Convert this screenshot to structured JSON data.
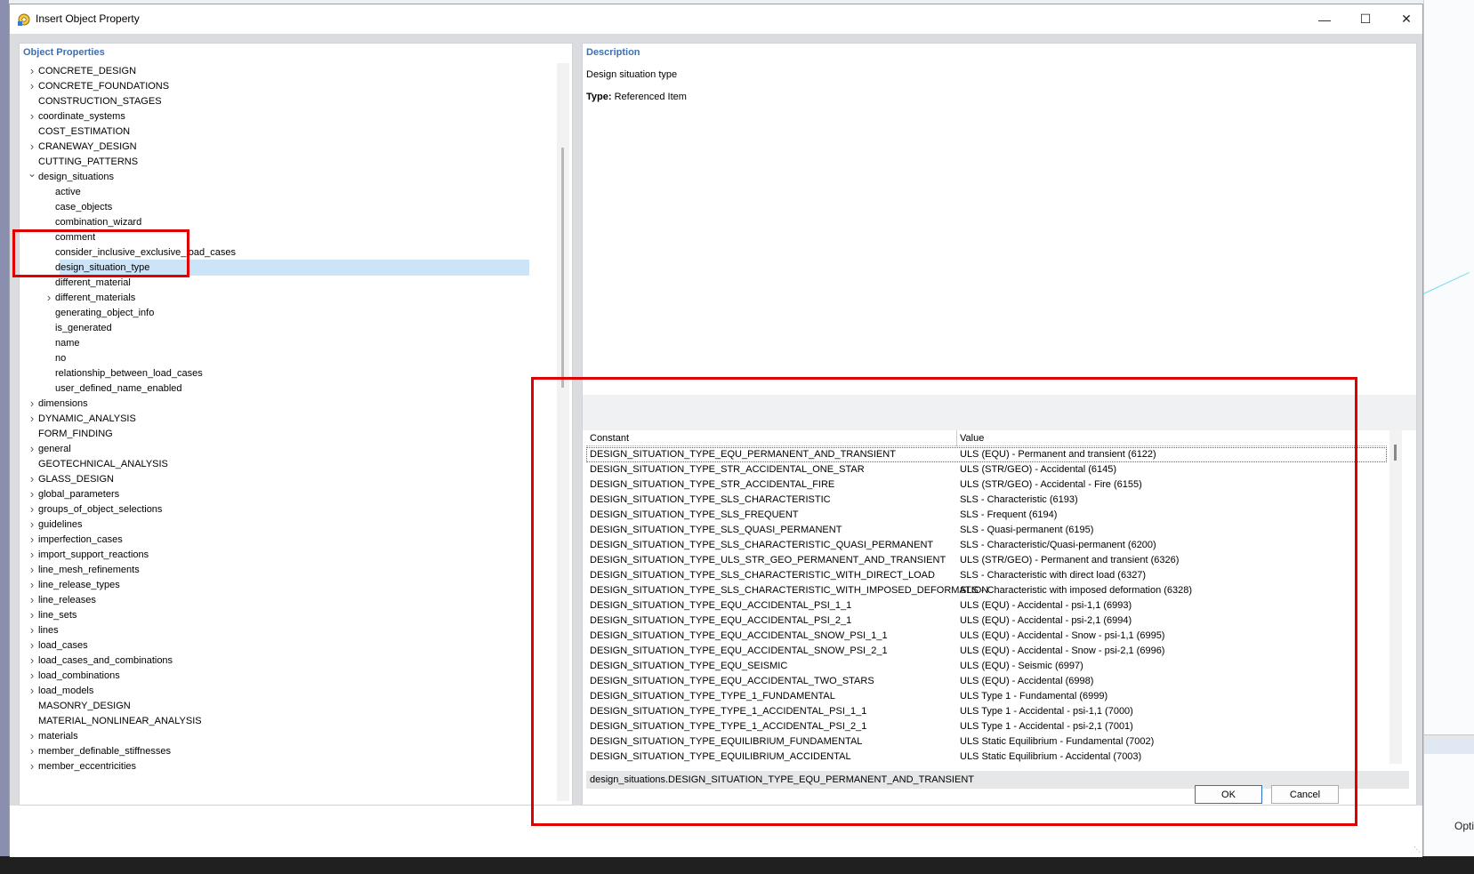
{
  "window": {
    "title": "Insert Object Property"
  },
  "left_panel": {
    "header": "Object Properties",
    "tree": [
      {
        "label": "CONCRETE_DESIGN",
        "expander": "collapsed",
        "level": 0
      },
      {
        "label": "CONCRETE_FOUNDATIONS",
        "expander": "collapsed",
        "level": 0
      },
      {
        "label": "CONSTRUCTION_STAGES",
        "expander": "none",
        "level": 0
      },
      {
        "label": "coordinate_systems",
        "expander": "collapsed",
        "level": 0
      },
      {
        "label": "COST_ESTIMATION",
        "expander": "none",
        "level": 0
      },
      {
        "label": "CRANEWAY_DESIGN",
        "expander": "collapsed",
        "level": 0
      },
      {
        "label": "CUTTING_PATTERNS",
        "expander": "none",
        "level": 0
      },
      {
        "label": "design_situations",
        "expander": "expanded",
        "level": 0
      },
      {
        "label": "active",
        "expander": "none",
        "level": 1
      },
      {
        "label": "case_objects",
        "expander": "none",
        "level": 1
      },
      {
        "label": "combination_wizard",
        "expander": "none",
        "level": 1
      },
      {
        "label": "comment",
        "expander": "none",
        "level": 1
      },
      {
        "label": "consider_inclusive_exclusive_load_cases",
        "expander": "none",
        "level": 1
      },
      {
        "label": "design_situation_type",
        "expander": "none",
        "level": 1,
        "selected": true
      },
      {
        "label": "different_material",
        "expander": "none",
        "level": 1
      },
      {
        "label": "different_materials",
        "expander": "collapsed",
        "level": 1
      },
      {
        "label": "generating_object_info",
        "expander": "none",
        "level": 1
      },
      {
        "label": "is_generated",
        "expander": "none",
        "level": 1
      },
      {
        "label": "name",
        "expander": "none",
        "level": 1
      },
      {
        "label": "no",
        "expander": "none",
        "level": 1
      },
      {
        "label": "relationship_between_load_cases",
        "expander": "none",
        "level": 1
      },
      {
        "label": "user_defined_name_enabled",
        "expander": "none",
        "level": 1
      },
      {
        "label": "dimensions",
        "expander": "collapsed",
        "level": 0
      },
      {
        "label": "DYNAMIC_ANALYSIS",
        "expander": "collapsed",
        "level": 0
      },
      {
        "label": "FORM_FINDING",
        "expander": "none",
        "level": 0
      },
      {
        "label": "general",
        "expander": "collapsed",
        "level": 0
      },
      {
        "label": "GEOTECHNICAL_ANALYSIS",
        "expander": "none",
        "level": 0
      },
      {
        "label": "GLASS_DESIGN",
        "expander": "collapsed",
        "level": 0
      },
      {
        "label": "global_parameters",
        "expander": "collapsed",
        "level": 0
      },
      {
        "label": "groups_of_object_selections",
        "expander": "collapsed",
        "level": 0
      },
      {
        "label": "guidelines",
        "expander": "collapsed",
        "level": 0
      },
      {
        "label": "imperfection_cases",
        "expander": "collapsed",
        "level": 0
      },
      {
        "label": "import_support_reactions",
        "expander": "collapsed",
        "level": 0
      },
      {
        "label": "line_mesh_refinements",
        "expander": "collapsed",
        "level": 0
      },
      {
        "label": "line_release_types",
        "expander": "collapsed",
        "level": 0
      },
      {
        "label": "line_releases",
        "expander": "collapsed",
        "level": 0
      },
      {
        "label": "line_sets",
        "expander": "collapsed",
        "level": 0
      },
      {
        "label": "lines",
        "expander": "collapsed",
        "level": 0
      },
      {
        "label": "load_cases",
        "expander": "collapsed",
        "level": 0
      },
      {
        "label": "load_cases_and_combinations",
        "expander": "collapsed",
        "level": 0
      },
      {
        "label": "load_combinations",
        "expander": "collapsed",
        "level": 0
      },
      {
        "label": "load_models",
        "expander": "collapsed",
        "level": 0
      },
      {
        "label": "MASONRY_DESIGN",
        "expander": "none",
        "level": 0
      },
      {
        "label": "MATERIAL_NONLINEAR_ANALYSIS",
        "expander": "none",
        "level": 0
      },
      {
        "label": "materials",
        "expander": "collapsed",
        "level": 0
      },
      {
        "label": "member_definable_stiffnesses",
        "expander": "collapsed",
        "level": 0
      },
      {
        "label": "member_eccentricities",
        "expander": "collapsed",
        "level": 0
      }
    ]
  },
  "right_panel": {
    "header": "Description",
    "description": "Design situation type",
    "type_label": "Type:",
    "type_value": "Referenced Item",
    "table": {
      "columns": [
        "Constant",
        "Value"
      ],
      "rows": [
        [
          "DESIGN_SITUATION_TYPE_EQU_PERMANENT_AND_TRANSIENT",
          "ULS (EQU) - Permanent and transient (6122)"
        ],
        [
          "DESIGN_SITUATION_TYPE_STR_ACCIDENTAL_ONE_STAR",
          "ULS (STR/GEO) - Accidental (6145)"
        ],
        [
          "DESIGN_SITUATION_TYPE_STR_ACCIDENTAL_FIRE",
          "ULS (STR/GEO) - Accidental - Fire (6155)"
        ],
        [
          "DESIGN_SITUATION_TYPE_SLS_CHARACTERISTIC",
          "SLS - Characteristic (6193)"
        ],
        [
          "DESIGN_SITUATION_TYPE_SLS_FREQUENT",
          "SLS - Frequent (6194)"
        ],
        [
          "DESIGN_SITUATION_TYPE_SLS_QUASI_PERMANENT",
          "SLS - Quasi-permanent (6195)"
        ],
        [
          "DESIGN_SITUATION_TYPE_SLS_CHARACTERISTIC_QUASI_PERMANENT",
          "SLS - Characteristic/Quasi-permanent (6200)"
        ],
        [
          "DESIGN_SITUATION_TYPE_ULS_STR_GEO_PERMANENT_AND_TRANSIENT",
          "ULS (STR/GEO) - Permanent and transient (6326)"
        ],
        [
          "DESIGN_SITUATION_TYPE_SLS_CHARACTERISTIC_WITH_DIRECT_LOAD",
          "SLS - Characteristic with direct load (6327)"
        ],
        [
          "DESIGN_SITUATION_TYPE_SLS_CHARACTERISTIC_WITH_IMPOSED_DEFORMATION",
          "SLS - Characteristic with imposed deformation (6328)"
        ],
        [
          "DESIGN_SITUATION_TYPE_EQU_ACCIDENTAL_PSI_1_1",
          "ULS (EQU) - Accidental - psi-1,1 (6993)"
        ],
        [
          "DESIGN_SITUATION_TYPE_EQU_ACCIDENTAL_PSI_2_1",
          "ULS (EQU) - Accidental - psi-2,1 (6994)"
        ],
        [
          "DESIGN_SITUATION_TYPE_EQU_ACCIDENTAL_SNOW_PSI_1_1",
          "ULS (EQU) - Accidental - Snow - psi-1,1 (6995)"
        ],
        [
          "DESIGN_SITUATION_TYPE_EQU_ACCIDENTAL_SNOW_PSI_2_1",
          "ULS (EQU) - Accidental - Snow - psi-2,1 (6996)"
        ],
        [
          "DESIGN_SITUATION_TYPE_EQU_SEISMIC",
          "ULS (EQU) - Seismic (6997)"
        ],
        [
          "DESIGN_SITUATION_TYPE_EQU_ACCIDENTAL_TWO_STARS",
          "ULS (EQU) - Accidental (6998)"
        ],
        [
          "DESIGN_SITUATION_TYPE_TYPE_1_FUNDAMENTAL",
          "ULS Type 1 - Fundamental (6999)"
        ],
        [
          "DESIGN_SITUATION_TYPE_TYPE_1_ACCIDENTAL_PSI_1_1",
          "ULS Type 1 - Accidental - psi-1,1 (7000)"
        ],
        [
          "DESIGN_SITUATION_TYPE_TYPE_1_ACCIDENTAL_PSI_2_1",
          "ULS Type 1 - Accidental - psi-2,1 (7001)"
        ],
        [
          "DESIGN_SITUATION_TYPE_EQUILIBRIUM_FUNDAMENTAL",
          "ULS Static Equilibrium - Fundamental (7002)"
        ],
        [
          "DESIGN_SITUATION_TYPE_EQUILIBRIUM_ACCIDENTAL",
          "ULS Static Equilibrium - Accidental (7003)"
        ]
      ]
    },
    "path": "design_situations.DESIGN_SITUATION_TYPE_EQU_PERMANENT_AND_TRANSIENT"
  },
  "footer": {
    "ok_label": "OK",
    "cancel_label": "Cancel"
  },
  "background": {
    "opt_label": "Opti"
  },
  "colors": {
    "header_blue": "#3d6fb1",
    "selection": "#cce4f7",
    "highlight_red": "#e00000"
  }
}
